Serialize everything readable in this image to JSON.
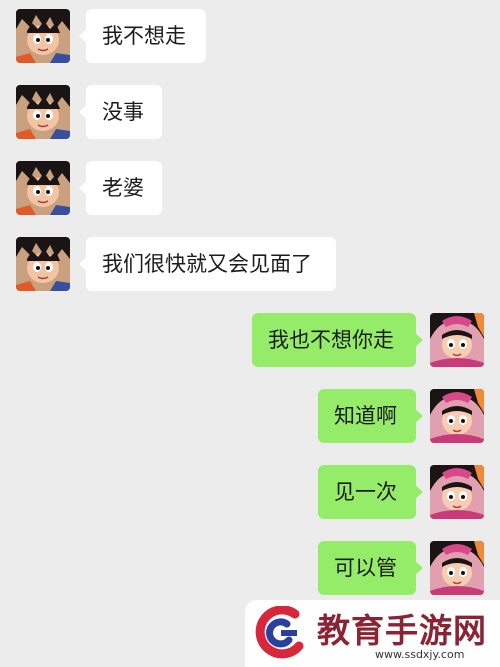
{
  "colors": {
    "background": "#ececec",
    "incoming_bubble": "#ffffff",
    "outgoing_bubble": "#95ec69",
    "watermark_text": "#8a2434"
  },
  "messages": [
    {
      "side": "left",
      "text": "我不想走",
      "avatar": "goku-avatar"
    },
    {
      "side": "left",
      "text": "没事",
      "avatar": "goku-avatar"
    },
    {
      "side": "left",
      "text": "老婆",
      "avatar": "goku-avatar"
    },
    {
      "side": "left",
      "text": "我们很快就又会见面了",
      "avatar": "goku-avatar"
    },
    {
      "side": "right",
      "text": "我也不想你走",
      "avatar": "chichi-avatar"
    },
    {
      "side": "right",
      "text": "知道啊",
      "avatar": "chichi-avatar"
    },
    {
      "side": "right",
      "text": "见一次",
      "avatar": "chichi-avatar"
    },
    {
      "side": "right",
      "text": "可以管",
      "avatar": "chichi-avatar"
    }
  ],
  "watermark": {
    "title": "教育手游网",
    "url": "www.ssdxjy.com"
  }
}
